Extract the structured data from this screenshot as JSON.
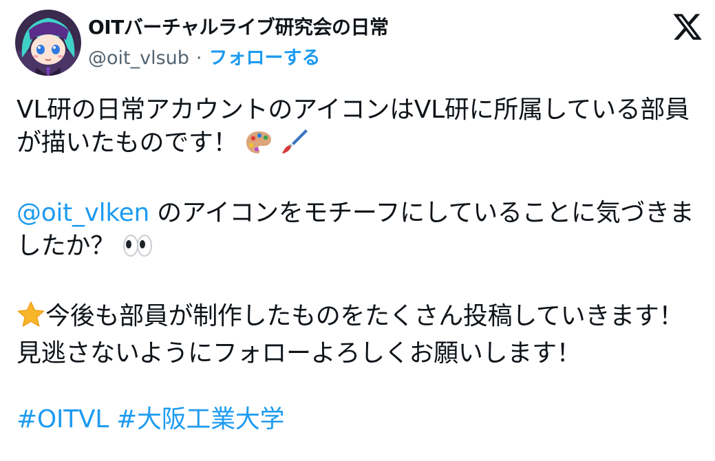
{
  "colors": {
    "link": "#1d9bf0",
    "text": "#0f1419",
    "secondary": "#536471"
  },
  "header": {
    "avatar_icon": "anime-character-avatar",
    "display_name": "OITバーチャルライブ研究会の日常",
    "handle": "@oit_vlsub",
    "separator": "·",
    "follow_label": "フォローする",
    "logo_icon": "x-logo-icon"
  },
  "tweet": {
    "p1_text": "VL研の日常アカウントのアイコンはVL研に所属している部員が描いたものです！",
    "p1_emojis": [
      "palette-emoji",
      "paintbrush-emoji"
    ],
    "p2_mention": "@oit_vlken",
    "p2_text": " のアイコンをモチーフにしていることに気づきましたか？",
    "p2_emoji": "eyes-emoji",
    "p3_emoji": "star-emoji",
    "p3_text": "今後も部員が制作したものをたくさん投稿していきます！見逃さないようにフォローよろしくお願いします！",
    "hashtag1": "#OITVL",
    "hashtag2": "#大阪工業大学"
  }
}
